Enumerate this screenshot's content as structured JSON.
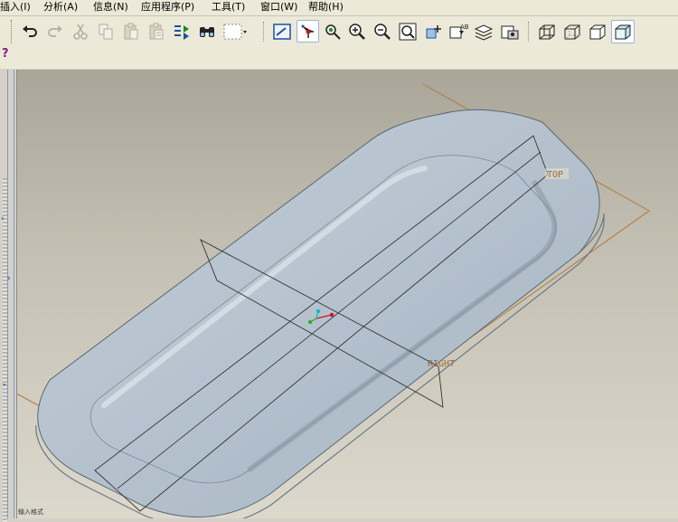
{
  "menu": {
    "items": [
      {
        "label": "插入(I)"
      },
      {
        "label": "分析(A)"
      },
      {
        "label": "信息(N)"
      },
      {
        "label": "应用程序(P)"
      },
      {
        "label": "工具(T)"
      },
      {
        "label": "窗口(W)"
      },
      {
        "label": "帮助(H)"
      }
    ]
  },
  "toolbar": {
    "help_glyph": "?",
    "buttons": [
      {
        "icon": "undo-icon"
      },
      {
        "icon": "redo-icon"
      },
      {
        "icon": "cut-icon"
      },
      {
        "icon": "copy-icon"
      },
      {
        "icon": "paste-icon"
      },
      {
        "icon": "paste-special-icon"
      },
      {
        "icon": "regenerate-icon"
      },
      {
        "icon": "find-icon"
      },
      {
        "icon": "selection-box-icon"
      },
      {
        "icon": "repaint-icon"
      },
      {
        "icon": "spin-center-icon"
      },
      {
        "icon": "orient-mode-icon"
      },
      {
        "icon": "zoom-in-icon"
      },
      {
        "icon": "zoom-out-icon"
      },
      {
        "icon": "refit-icon"
      },
      {
        "icon": "reorient-icon"
      },
      {
        "icon": "saved-views-icon"
      },
      {
        "icon": "layers-icon"
      },
      {
        "icon": "view-manager-icon"
      },
      {
        "icon": "wireframe-icon"
      },
      {
        "icon": "hidden-line-icon"
      },
      {
        "icon": "no-hidden-icon"
      },
      {
        "icon": "shading-icon"
      }
    ]
  },
  "viewport": {
    "datum_labels": {
      "top": "TOP",
      "right": "RIGHT",
      "front": "T"
    },
    "status_text": "输入格式"
  },
  "colors": {
    "part": "#b5c2cd",
    "datum_plane": "#b0793c",
    "label": "#a06b3a",
    "background_top": "#a9a598",
    "background_bottom": "#dcd9cc"
  }
}
